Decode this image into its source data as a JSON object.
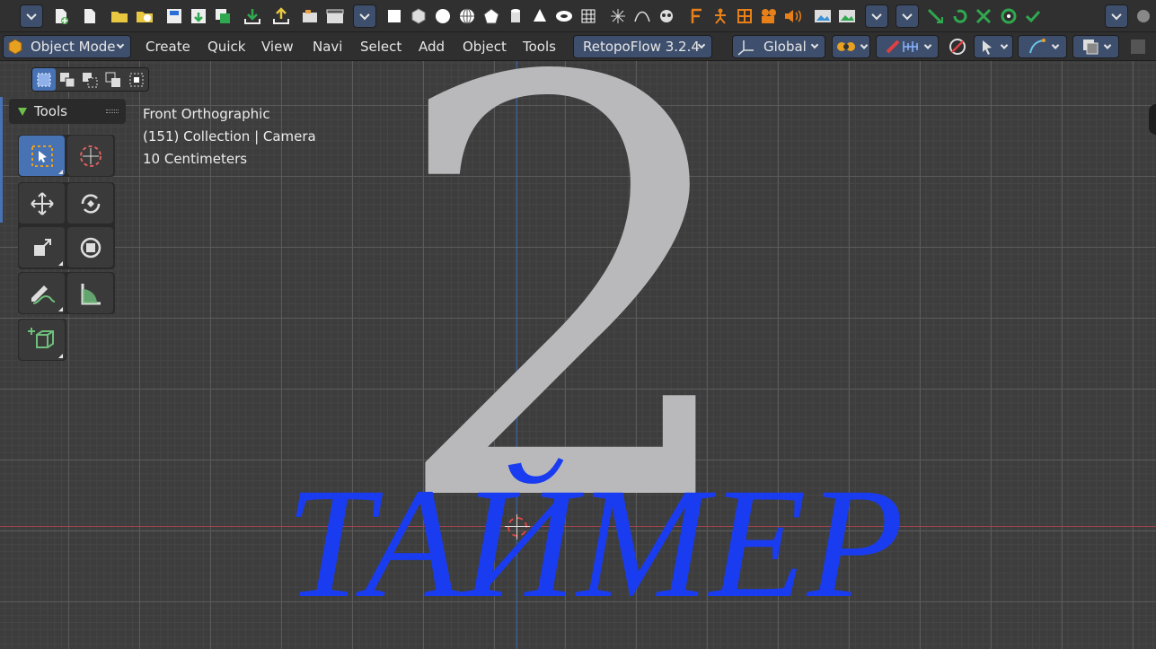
{
  "toolbar": {
    "icons": [
      "dropdown",
      "new-file-icon",
      "file-icon",
      "folder-icon",
      "recent-icon",
      "save-icon",
      "save-as-icon",
      "copy-icon",
      "import-icon",
      "export-icon",
      "render-icon",
      "clapper-icon",
      "dropdown",
      "plane-icon",
      "cube-icon",
      "sphere-icon",
      "globe-icon",
      "ico-icon",
      "cylinder-icon",
      "cone-icon",
      "torus-icon",
      "grid-icon",
      "empty-icon",
      "curve-icon",
      "monkey-icon",
      "font-icon",
      "armature-icon",
      "lattice-icon",
      "camera-icon",
      "speaker-icon",
      "image-icon",
      "image2-icon",
      "dropdown",
      "dropdown",
      "snap-icon",
      "rotate-icon",
      "scale-icon",
      "transform-icon",
      "apply-icon",
      "dropdown",
      "properties-icon"
    ]
  },
  "header": {
    "mode_label": "Object Mode",
    "menu": [
      "Create",
      "Quick",
      "View",
      "Navi",
      "Select",
      "Add",
      "Object",
      "Tools"
    ],
    "addon_label": "RetopoFlow 3.2.4",
    "orientation_label": "Global"
  },
  "tools_panel": {
    "title": "Tools"
  },
  "viewport": {
    "view_name": "Front Orthographic",
    "collection_info": "(151) Collection | Camera",
    "scale_info": "10 Centimeters",
    "big_text": "2",
    "title_text": "ТАЙМЕР"
  },
  "colors": {
    "accent": "#4772b3",
    "dropdown": "#3e4f6d",
    "title_blue": "#1a3cf0",
    "numeral_grey": "#b9b9bb"
  }
}
